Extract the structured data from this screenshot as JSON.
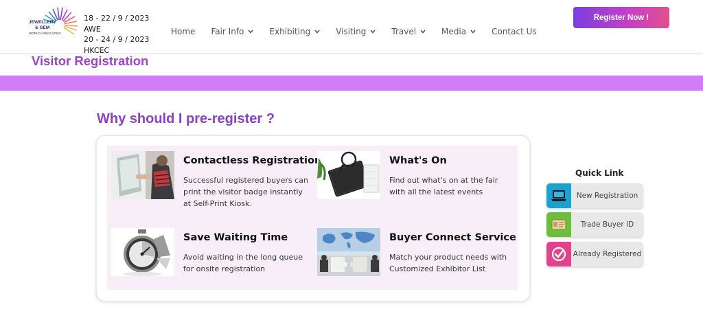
{
  "header": {
    "logo": {
      "line1": "JEWELLERY",
      "line2": "& GEM",
      "line3": "WORLD HONG KONG"
    },
    "dates": [
      "18 - 22 / 9 / 2023",
      "AWE",
      "20 - 24 / 9 / 2023",
      "HKCEC"
    ],
    "nav": [
      {
        "label": "Home",
        "dropdown": false
      },
      {
        "label": "Fair Info",
        "dropdown": true
      },
      {
        "label": "Exhibiting",
        "dropdown": true
      },
      {
        "label": "Visiting",
        "dropdown": true
      },
      {
        "label": "Travel",
        "dropdown": true
      },
      {
        "label": "Media",
        "dropdown": true
      },
      {
        "label": "Contact Us",
        "dropdown": false
      }
    ],
    "register_label": "Register Now !"
  },
  "page_title": "Visitor Registration",
  "section_title": "Why should I pre-register ?",
  "features": [
    {
      "title": "Contactless Registration",
      "description": "Successful registered buyers can print the visitor badge instantly at Self-Print Kiosk."
    },
    {
      "title": "What's On",
      "description": "Find out what's on at the fair with all the latest events"
    },
    {
      "title": "Save Waiting Time",
      "description": "Avoid waiting in the long queue for onsite registration"
    },
    {
      "title": "Buyer Connect Service",
      "description": "Match your product needs with Customized Exhibitor List"
    }
  ],
  "quick_link": {
    "title": "Quick Link",
    "items": [
      {
        "label": "New Registration",
        "icon": "laptop-icon",
        "color": "#1aa3d0"
      },
      {
        "label": "Trade Buyer ID",
        "icon": "id-card-icon",
        "color": "#6bbf3a"
      },
      {
        "label": "Already Registered",
        "icon": "check-circle-icon",
        "color": "#e0448f"
      }
    ]
  },
  "colors": {
    "accent": "#9b44c9",
    "band": "#cf7cf6",
    "card_bg": "#f7eef7"
  }
}
